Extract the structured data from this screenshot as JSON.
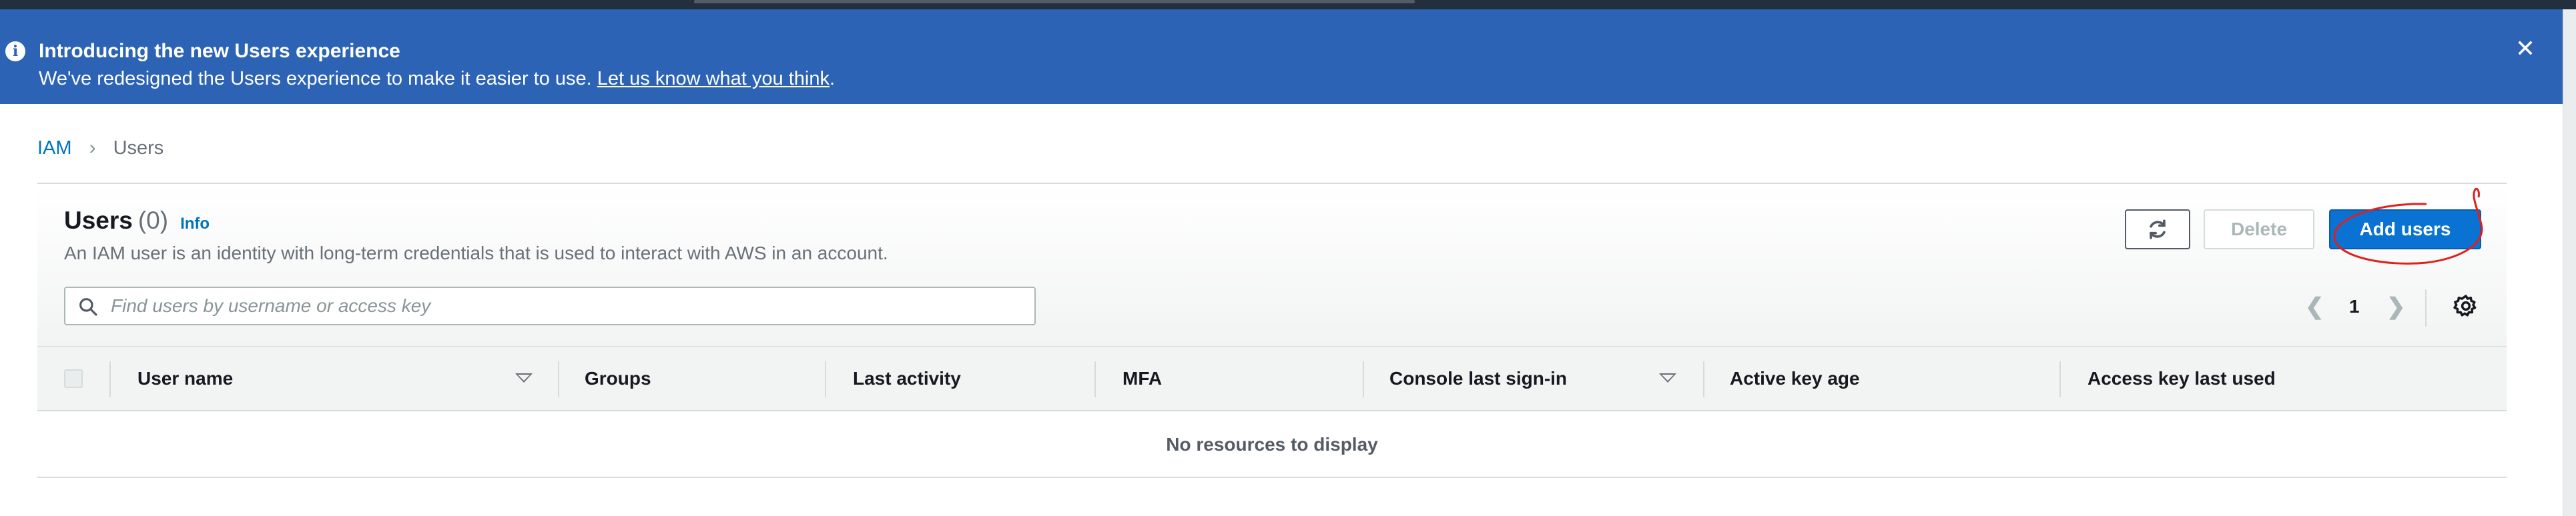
{
  "banner": {
    "title": "Introducing the new Users experience",
    "message": "We've redesigned the Users experience to make it easier to use.",
    "link_text": "Let us know what you think",
    "link_suffix": ".",
    "info_icon": "info-icon",
    "close_icon": "close-icon",
    "background_color": "#2c63b4"
  },
  "breadcrumb": {
    "root": "IAM",
    "current": "Users"
  },
  "header": {
    "title": "Users",
    "count": "(0)",
    "info_link": "Info",
    "description": "An IAM user is an identity with long-term credentials that is used to interact with AWS in an account."
  },
  "actions": {
    "refresh_icon": "refresh-icon",
    "delete_label": "Delete",
    "add_label": "Add users",
    "primary_color": "#0972d3"
  },
  "search": {
    "placeholder": "Find users by username or access key",
    "value": ""
  },
  "pagination": {
    "current_page": "1",
    "prev_icon": "chevron-left-icon",
    "next_icon": "chevron-right-icon",
    "settings_icon": "gear-icon"
  },
  "table": {
    "columns": [
      "User name",
      "Groups",
      "Last activity",
      "MFA",
      "Console last sign-in",
      "Active key age",
      "Access key last used"
    ],
    "empty_message": "No resources to display"
  }
}
